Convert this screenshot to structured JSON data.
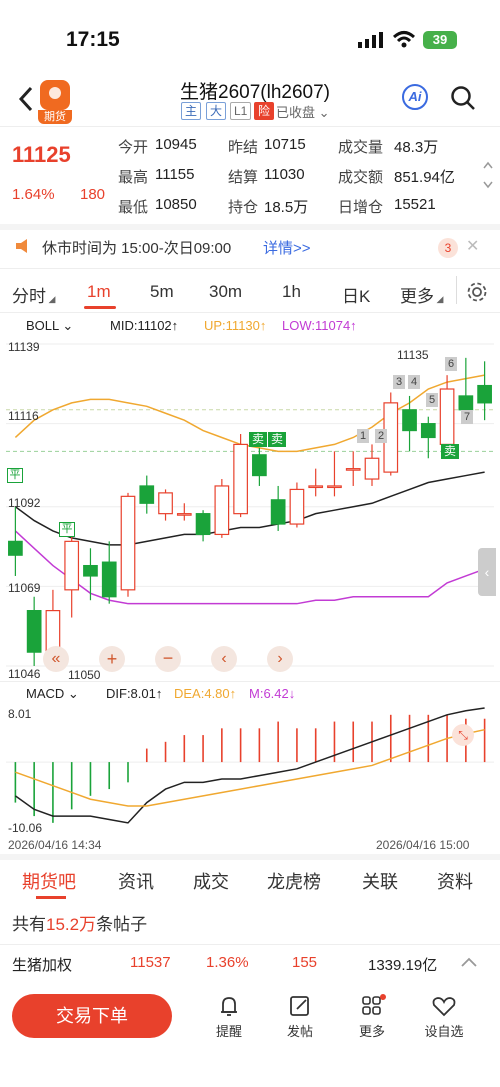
{
  "status": {
    "time": "17:15",
    "battery": "39"
  },
  "header": {
    "title": "生猪2607(lh2607)",
    "badge": "期货",
    "tags": [
      "主",
      "大",
      "L1",
      "险"
    ],
    "closed": "已收盘",
    "ai": "Ai"
  },
  "quote": {
    "price": "11125",
    "pct": "1.64%",
    "change": "180",
    "fields": [
      {
        "label": "今开",
        "value": "10945",
        "color": "dark"
      },
      {
        "label": "昨结",
        "value": "10715",
        "color": "dark"
      },
      {
        "label": "成交量",
        "value": "48.3万",
        "color": "dark"
      },
      {
        "label": "最高",
        "value": "11155",
        "color": "red"
      },
      {
        "label": "结算",
        "value": "11030",
        "color": "dark"
      },
      {
        "label": "成交额",
        "value": "851.94亿",
        "color": "dark"
      },
      {
        "label": "最低",
        "value": "10850",
        "color": "green"
      },
      {
        "label": "持仓",
        "value": "18.5万",
        "color": "dark"
      },
      {
        "label": "日增仓",
        "value": "15521",
        "color": "red"
      }
    ]
  },
  "notice": {
    "text": "休市时间为 15:00-次日09:00",
    "link": "详情>>",
    "count": "3"
  },
  "period_tabs": [
    "分时",
    "1m",
    "5m",
    "30m",
    "1h",
    "日K",
    "更多"
  ],
  "boll": {
    "name": "BOLL",
    "mid": "MID:11102↑",
    "up": "UP:11130↑",
    "low": "LOW:11074↑"
  },
  "price_axis": {
    "top": "11139",
    "l2": "11116",
    "l3": "11092",
    "l4": "11069",
    "bottom": "11046",
    "low_mark": "11050",
    "high_mark": "11135"
  },
  "markers": {
    "sell": "卖",
    "flat": "平",
    "nums": [
      "1",
      "2",
      "3",
      "4",
      "5",
      "6",
      "7"
    ]
  },
  "macd": {
    "name": "MACD",
    "dif": "DIF:8.01↑",
    "dea": "DEA:4.80↑",
    "m": "M:6.42↓",
    "top": "8.01",
    "bottom": "-10.06"
  },
  "time_axis": {
    "start": "2026/04/16 14:34",
    "end": "2026/04/16 15:00"
  },
  "colors": {
    "up": "#e8412c",
    "down": "#1aa33a",
    "mid": "#222222",
    "upper": "#f0a830",
    "lower": "#c23bd4",
    "dea": "#f0a830"
  },
  "bottom_tabs": [
    "期货吧",
    "资讯",
    "成交",
    "龙虎榜",
    "关联",
    "资料"
  ],
  "posts": {
    "prefix": "共有",
    "count": "15.2万",
    "suffix": "条帖子"
  },
  "ticker": {
    "name": "生猪加权",
    "price": "11537",
    "pct": "1.36%",
    "change": "155",
    "amount": "1339.19亿"
  },
  "bottom_bar": {
    "trade": "交易下单",
    "items": [
      "提醒",
      "发帖",
      "更多",
      "设自选"
    ]
  },
  "chart_data": [
    {
      "type": "candlestick",
      "title": "BOLL",
      "ylim": [
        11046,
        11139
      ],
      "x": [
        "14:34",
        "",
        "",
        "",
        "",
        "",
        "",
        "",
        "",
        "",
        "",
        "",
        "",
        "",
        "",
        "",
        "",
        "",
        "",
        "",
        "",
        "",
        "",
        "",
        "",
        "15:00"
      ],
      "candles": [
        {
          "o": 11082,
          "c": 11078,
          "h": 11092,
          "l": 11072
        },
        {
          "o": 11062,
          "c": 11050,
          "h": 11066,
          "l": 11046
        },
        {
          "o": 11050,
          "c": 11062,
          "h": 11068,
          "l": 11048
        },
        {
          "o": 11068,
          "c": 11082,
          "h": 11085,
          "l": 11060
        },
        {
          "o": 11075,
          "c": 11072,
          "h": 11080,
          "l": 11065
        },
        {
          "o": 11076,
          "c": 11066,
          "h": 11082,
          "l": 11064
        },
        {
          "o": 11068,
          "c": 11095,
          "h": 11096,
          "l": 11066
        },
        {
          "o": 11098,
          "c": 11093,
          "h": 11101,
          "l": 11090
        },
        {
          "o": 11090,
          "c": 11096,
          "h": 11097,
          "l": 11088
        },
        {
          "o": 11090,
          "c": 11090,
          "h": 11093,
          "l": 11088
        },
        {
          "o": 11090,
          "c": 11084,
          "h": 11091,
          "l": 11082
        },
        {
          "o": 11084,
          "c": 11098,
          "h": 11100,
          "l": 11083
        },
        {
          "o": 11090,
          "c": 11110,
          "h": 11113,
          "l": 11089
        },
        {
          "o": 11107,
          "c": 11101,
          "h": 11109,
          "l": 11098
        },
        {
          "o": 11094,
          "c": 11087,
          "h": 11098,
          "l": 11085
        },
        {
          "o": 11087,
          "c": 11097,
          "h": 11099,
          "l": 11086
        },
        {
          "o": 11098,
          "c": 11098,
          "h": 11103,
          "l": 11095
        },
        {
          "o": 11098,
          "c": 11098,
          "h": 11108,
          "l": 11095
        },
        {
          "o": 11103,
          "c": 11103,
          "h": 11108,
          "l": 11098
        },
        {
          "o": 11100,
          "c": 11106,
          "h": 11110,
          "l": 11098
        },
        {
          "o": 11102,
          "c": 11122,
          "h": 11125,
          "l": 11101
        },
        {
          "o": 11120,
          "c": 11114,
          "h": 11124,
          "l": 11108
        },
        {
          "o": 11116,
          "c": 11112,
          "h": 11118,
          "l": 11106
        },
        {
          "o": 11110,
          "c": 11126,
          "h": 11130,
          "l": 11108
        },
        {
          "o": 11124,
          "c": 11120,
          "h": 11135,
          "l": 11118
        },
        {
          "o": 11127,
          "c": 11122,
          "h": 11134,
          "l": 11117
        }
      ],
      "boll_mid": [
        11092,
        11088,
        11085,
        11083,
        11082,
        11081,
        11081,
        11082,
        11083,
        11084,
        11084,
        11085,
        11086,
        11086,
        11087,
        11088,
        11090,
        11091,
        11092,
        11093,
        11095,
        11097,
        11099,
        11100,
        11101,
        11102
      ],
      "boll_up": [
        11112,
        11117,
        11120,
        11122,
        11123,
        11123,
        11122,
        11121,
        11119,
        11117,
        11114,
        11112,
        11110,
        11109,
        11108,
        11108,
        11109,
        11110,
        11112,
        11115,
        11119,
        11122,
        11126,
        11128,
        11129,
        11130
      ],
      "boll_low": [
        11085,
        11080,
        11075,
        11071,
        11067,
        11065,
        11064,
        11064,
        11064,
        11064,
        11064,
        11064,
        11064,
        11064,
        11064,
        11064,
        11065,
        11065,
        11066,
        11066,
        11066,
        11066,
        11066,
        11070,
        11072,
        11074
      ]
    },
    {
      "type": "bar",
      "title": "MACD",
      "ylim": [
        -10.06,
        8.01
      ],
      "values": [
        -6,
        -8,
        -9,
        -7,
        -5,
        -4,
        -3,
        2,
        3,
        4,
        4,
        5,
        5,
        5,
        6,
        5,
        5,
        6,
        6,
        6,
        7,
        7,
        7,
        7,
        6.42,
        6.42
      ],
      "series": [
        {
          "name": "DIF",
          "values": [
            -5,
            -7,
            -8,
            -8,
            -8,
            -8.5,
            -9,
            -6,
            -4,
            -3,
            -3,
            -2.5,
            -2.5,
            -2,
            -1.5,
            -1,
            0,
            1,
            2,
            3,
            4,
            5,
            6,
            7,
            7.6,
            8.01
          ]
        },
        {
          "name": "DEA",
          "values": [
            -1.5,
            -2.5,
            -3.5,
            -4.5,
            -5.5,
            -6,
            -6.5,
            -6.5,
            -6,
            -5.5,
            -5,
            -4.5,
            -4,
            -3.5,
            -3,
            -2.5,
            -2,
            -1.5,
            -1,
            -0.5,
            0.5,
            1.5,
            2.5,
            3.5,
            4.2,
            4.8
          ]
        }
      ]
    }
  ]
}
